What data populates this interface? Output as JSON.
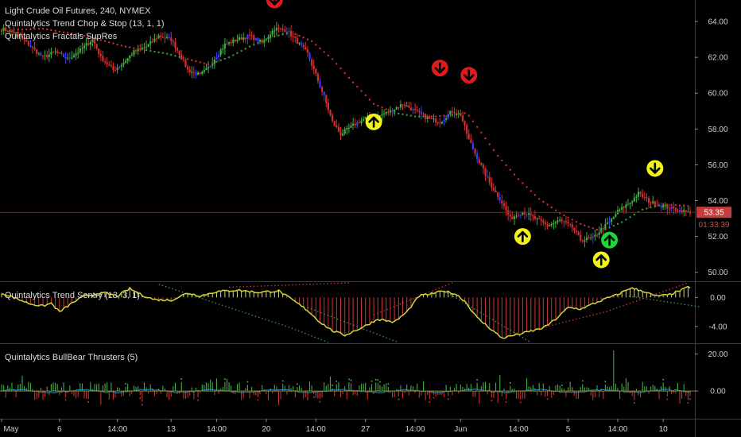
{
  "chart_data": [
    {
      "type": "candlestick",
      "legend": [
        "Light Crude Oil Futures, 240, NYMEX",
        "Quintalytics Trend Chop & Stop (13, 1, 1)",
        "Quintalytics Fractals SupRes"
      ],
      "ylim": [
        49.5,
        65.2
      ],
      "yticks": [
        "64.00",
        "62.00",
        "60.00",
        "58.00",
        "56.00",
        "54.00",
        "52.00",
        "50.00"
      ],
      "last_price": "53.35",
      "countdown": "01:33:39",
      "price_path": [
        [
          0,
          63.6
        ],
        [
          8,
          63.3
        ],
        [
          14,
          62.6
        ],
        [
          20,
          62.0
        ],
        [
          26,
          62.3
        ],
        [
          32,
          61.9
        ],
        [
          38,
          62.4
        ],
        [
          44,
          63.0
        ],
        [
          48,
          62.0
        ],
        [
          54,
          61.3
        ],
        [
          58,
          61.6
        ],
        [
          64,
          62.3
        ],
        [
          70,
          62.6
        ],
        [
          76,
          63.2
        ],
        [
          82,
          63.0
        ],
        [
          86,
          62.2
        ],
        [
          90,
          61.3
        ],
        [
          96,
          61.0
        ],
        [
          100,
          61.4
        ],
        [
          104,
          62.1
        ],
        [
          108,
          62.7
        ],
        [
          114,
          63.0
        ],
        [
          120,
          63.2
        ],
        [
          126,
          62.8
        ],
        [
          132,
          63.6
        ],
        [
          138,
          63.5
        ],
        [
          142,
          63.0
        ],
        [
          148,
          62.2
        ],
        [
          152,
          61.0
        ],
        [
          156,
          59.8
        ],
        [
          160,
          58.4
        ],
        [
          164,
          57.7
        ],
        [
          170,
          58.2
        ],
        [
          176,
          58.6
        ],
        [
          182,
          58.7
        ],
        [
          188,
          59.0
        ],
        [
          194,
          59.4
        ],
        [
          200,
          59.0
        ],
        [
          206,
          58.6
        ],
        [
          212,
          58.4
        ],
        [
          218,
          59.0
        ],
        [
          222,
          58.8
        ],
        [
          226,
          57.4
        ],
        [
          230,
          56.4
        ],
        [
          236,
          55.0
        ],
        [
          242,
          53.9
        ],
        [
          246,
          53.0
        ],
        [
          252,
          53.4
        ],
        [
          258,
          53.0
        ],
        [
          264,
          52.6
        ],
        [
          270,
          52.9
        ],
        [
          276,
          52.5
        ],
        [
          280,
          51.8
        ],
        [
          286,
          51.9
        ],
        [
          290,
          52.4
        ],
        [
          294,
          52.8
        ],
        [
          298,
          53.4
        ],
        [
          304,
          53.9
        ],
        [
          308,
          54.4
        ],
        [
          314,
          53.9
        ],
        [
          320,
          53.7
        ],
        [
          326,
          53.5
        ],
        [
          332,
          53.35
        ]
      ],
      "stop_line": [
        [
          0,
          63.5
        ],
        [
          20,
          63.6
        ],
        [
          40,
          63.2
        ],
        [
          60,
          62.6
        ],
        [
          80,
          62.2
        ],
        [
          100,
          61.6
        ],
        [
          110,
          62.0
        ],
        [
          120,
          62.6
        ],
        [
          130,
          63.1
        ],
        [
          140,
          63.4
        ],
        [
          150,
          62.9
        ],
        [
          160,
          61.9
        ],
        [
          170,
          60.6
        ],
        [
          180,
          59.4
        ],
        [
          190,
          58.9
        ],
        [
          200,
          58.7
        ],
        [
          210,
          58.7
        ],
        [
          220,
          58.8
        ],
        [
          225,
          58.9
        ],
        [
          232,
          57.8
        ],
        [
          240,
          56.5
        ],
        [
          250,
          55.2
        ],
        [
          260,
          54.1
        ],
        [
          270,
          53.3
        ],
        [
          280,
          52.7
        ],
        [
          290,
          52.3
        ],
        [
          300,
          52.8
        ],
        [
          310,
          53.5
        ],
        [
          320,
          53.8
        ],
        [
          332,
          53.7
        ]
      ],
      "trend_change_bar": 296,
      "signals": [
        {
          "bar": 132,
          "price": 65.2,
          "dir": "down",
          "color": "red"
        },
        {
          "bar": 180,
          "price": 58.4,
          "dir": "up",
          "color": "yellow"
        },
        {
          "bar": 212,
          "price": 61.4,
          "dir": "down",
          "color": "red"
        },
        {
          "bar": 226,
          "price": 61.0,
          "dir": "down",
          "color": "red"
        },
        {
          "bar": 252,
          "price": 52.0,
          "dir": "up",
          "color": "yellow"
        },
        {
          "bar": 290,
          "price": 50.7,
          "dir": "up",
          "color": "yellow"
        },
        {
          "bar": 294,
          "price": 51.8,
          "dir": "up",
          "color": "green"
        },
        {
          "bar": 316,
          "price": 55.8,
          "dir": "down",
          "color": "yellow"
        }
      ]
    },
    {
      "type": "histogram",
      "legend": "Quintalytics Trend Sentry (13, 3, 1)",
      "ylim": [
        -6.2,
        2.0
      ],
      "yticks": [
        "0.00",
        "-4.00"
      ],
      "path": [
        [
          0,
          0.6
        ],
        [
          14,
          -0.9
        ],
        [
          20,
          -1.2
        ],
        [
          24,
          -0.8
        ],
        [
          28,
          -2.0
        ],
        [
          34,
          -0.8
        ],
        [
          40,
          0.2
        ],
        [
          50,
          0.6
        ],
        [
          56,
          0.2
        ],
        [
          62,
          1.2
        ],
        [
          68,
          0.3
        ],
        [
          74,
          -0.3
        ],
        [
          82,
          -0.4
        ],
        [
          90,
          0.6
        ],
        [
          96,
          0.2
        ],
        [
          104,
          0.8
        ],
        [
          114,
          1.0
        ],
        [
          124,
          0.7
        ],
        [
          134,
          0.9
        ],
        [
          142,
          -0.6
        ],
        [
          148,
          -1.8
        ],
        [
          154,
          -3.4
        ],
        [
          160,
          -4.6
        ],
        [
          166,
          -5.2
        ],
        [
          174,
          -4.2
        ],
        [
          182,
          -3.0
        ],
        [
          190,
          -3.4
        ],
        [
          196,
          -2.0
        ],
        [
          202,
          0.2
        ],
        [
          208,
          0.5
        ],
        [
          214,
          0.9
        ],
        [
          220,
          0.4
        ],
        [
          224,
          -0.5
        ],
        [
          230,
          -2.8
        ],
        [
          236,
          -4.2
        ],
        [
          242,
          -5.6
        ],
        [
          248,
          -5.2
        ],
        [
          254,
          -4.8
        ],
        [
          262,
          -4.2
        ],
        [
          268,
          -3.0
        ],
        [
          274,
          -1.4
        ],
        [
          280,
          -1.6
        ],
        [
          286,
          -0.9
        ],
        [
          292,
          -0.2
        ],
        [
          298,
          0.4
        ],
        [
          304,
          1.3
        ],
        [
          310,
          0.9
        ],
        [
          316,
          0.2
        ],
        [
          322,
          0.3
        ],
        [
          328,
          0.9
        ],
        [
          332,
          1.4
        ]
      ],
      "dotted_lines": [
        {
          "color": "#c83a3a",
          "pts": [
            [
              110,
              1.4
            ],
            [
              168,
              2.0
            ]
          ]
        },
        {
          "color": "#c83a3a",
          "pts": [
            [
              180,
              -2.4
            ],
            [
              218,
              2.0
            ]
          ]
        },
        {
          "color": "#c83a3a",
          "pts": [
            [
              258,
              -4.4
            ],
            [
              292,
              -2.0
            ],
            [
              332,
              2.0
            ]
          ]
        },
        {
          "color": "#3f9a3f",
          "pts": [
            [
              76,
              1.8
            ],
            [
              140,
              -4.2
            ],
            [
              158,
              -6.2
            ]
          ]
        },
        {
          "color": "#3f9a3f",
          "pts": [
            [
              148,
              -1.4
            ],
            [
              192,
              -6.2
            ]
          ]
        },
        {
          "color": "#3f9a3f",
          "pts": [
            [
              214,
              0.9
            ],
            [
              256,
              -6.2
            ]
          ]
        },
        {
          "color": "#3f9a3f",
          "pts": [
            [
              300,
              0.3
            ],
            [
              338,
              -1.3
            ]
          ]
        }
      ]
    },
    {
      "type": "bar",
      "legend": "Quintalytics BullBear Thrusters (5)",
      "ylim": [
        -15.0,
        25.0
      ],
      "yticks": [
        "20.00",
        "0.00"
      ]
    }
  ],
  "xaxis": {
    "labels": [
      {
        "bar": 0,
        "text": "May"
      },
      {
        "bar": 28,
        "text": "6"
      },
      {
        "bar": 56,
        "text": "14:00"
      },
      {
        "bar": 82,
        "text": "13"
      },
      {
        "bar": 104,
        "text": "14:00"
      },
      {
        "bar": 128,
        "text": "20"
      },
      {
        "bar": 152,
        "text": "14:00"
      },
      {
        "bar": 176,
        "text": "27"
      },
      {
        "bar": 200,
        "text": "14:00"
      },
      {
        "bar": 222,
        "text": "Jun"
      },
      {
        "bar": 250,
        "text": "14:00"
      },
      {
        "bar": 274,
        "text": "5"
      },
      {
        "bar": 298,
        "text": "14:00"
      },
      {
        "bar": 320,
        "text": "10"
      }
    ]
  },
  "colors": {
    "up": "#3fae3f",
    "down": "#d62e2e",
    "neutral": "#3a3aff",
    "stop_up": "#3a9a3a",
    "stop_down": "#c93232",
    "price_line": "#7a2a10",
    "badge": "#d9353a",
    "hist_pos": "#d6d67a",
    "hist_neg": "#c73a3a",
    "osc": "#d4d43a",
    "thr_pos": "#3fae3f",
    "thr_neg": "#c83232",
    "thr_sig": "#1f8fc8",
    "signal_red": "#e01b1b",
    "signal_yellow": "#f2f21b",
    "signal_green": "#22d33a"
  }
}
